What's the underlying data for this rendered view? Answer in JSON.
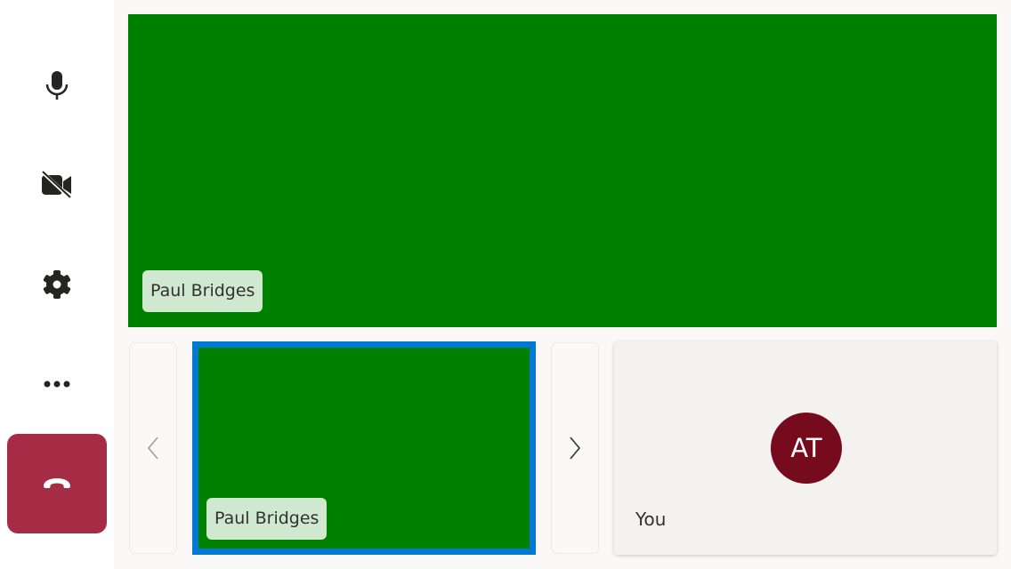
{
  "controls": [
    {
      "name": "microphone",
      "icon": "microphone-icon"
    },
    {
      "name": "camera",
      "icon": "camera-off-icon"
    },
    {
      "name": "settings",
      "icon": "gear-icon"
    },
    {
      "name": "more",
      "icon": "more-icon"
    },
    {
      "name": "hang-up",
      "icon": "phone-hangup-icon",
      "color": "#a52c44"
    }
  ],
  "main_video": {
    "participant": "Paul Bridges",
    "color": "#008000"
  },
  "gallery": {
    "tiles": [
      {
        "participant": "Paul Bridges",
        "selected": true,
        "border_color": "#0078d4"
      }
    ],
    "local": {
      "initials": "AT",
      "label": "You",
      "avatar_color": "#750b1c"
    }
  }
}
